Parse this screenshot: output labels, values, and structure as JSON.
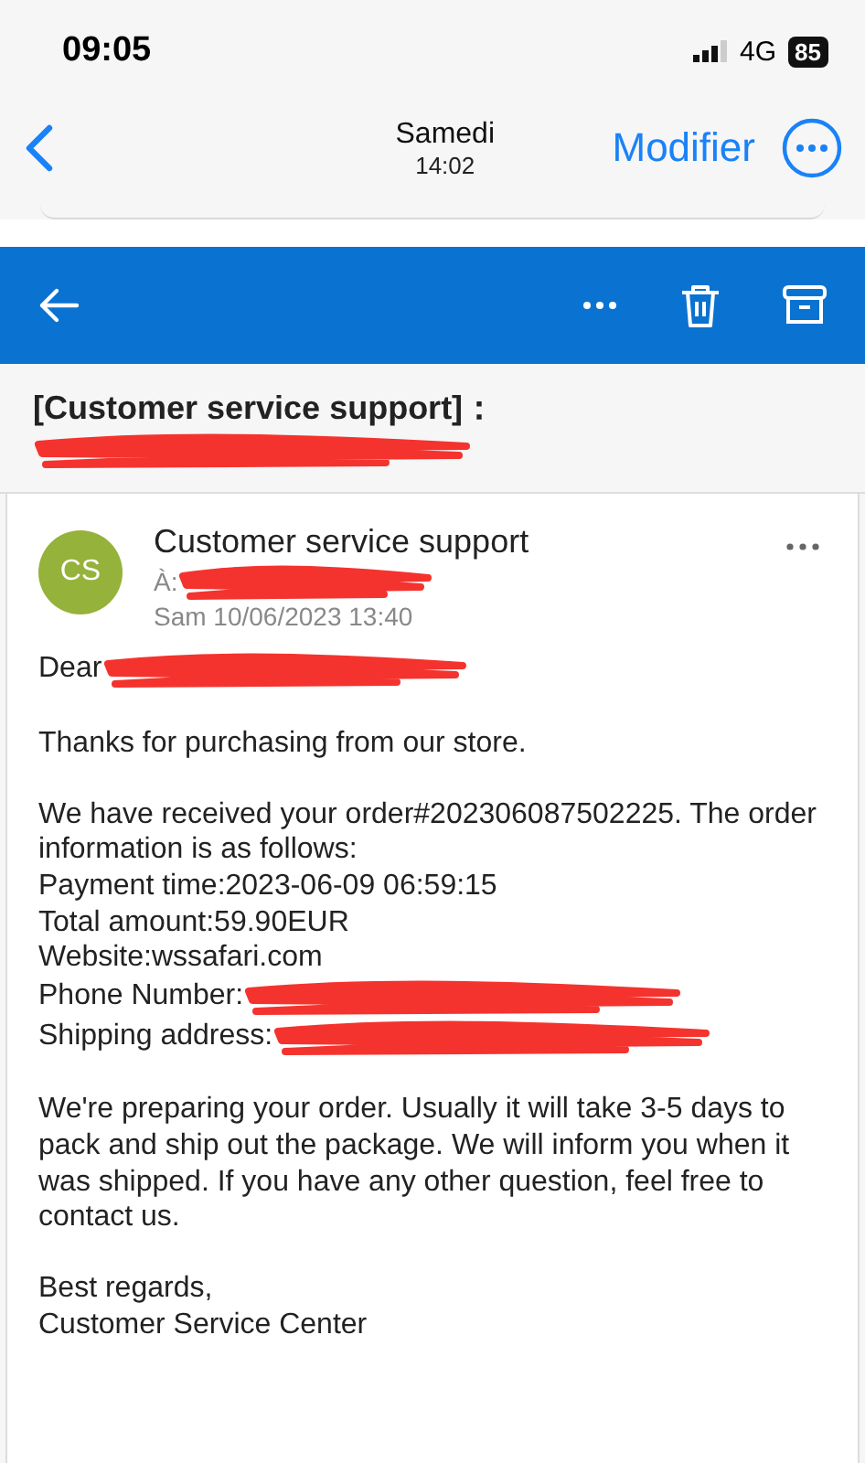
{
  "status_bar": {
    "time": "09:05",
    "network": "4G",
    "battery": "85"
  },
  "nav": {
    "title": "Samedi",
    "subtitle": "14:02",
    "action": "Modifier"
  },
  "subject": {
    "title": "[Customer service support]：",
    "redacted": true
  },
  "message": {
    "avatar": "CS",
    "sender": "Customer service support",
    "to": "À:",
    "to_redacted": true,
    "date": "Sam 10/06/2023 13:40",
    "paragraphs": [
      [
        {
          "text": "Dear",
          "redacted": true
        }
      ],
      [
        {
          "text": "Thanks for purchasing from our store.",
          "redacted": false
        }
      ],
      [
        {
          "text": "We have received your order#202306087502225. The order information is as follows:",
          "redacted": false
        },
        {
          "text": "Payment time:2023-06-09 06:59:15",
          "redacted": false
        },
        {
          "text": "Total amount:59.90EUR",
          "redacted": false
        },
        {
          "text": "Website:wssafari.com",
          "redacted": false
        },
        {
          "text": "Phone Number:",
          "redacted": true
        },
        {
          "text": "Shipping address:",
          "redacted": true
        }
      ],
      [
        {
          "text": "We're preparing your order. Usually it will take 3-5 days to pack and ship out the package. We will inform you when it was shipped. If you have any other question, feel free to contact us.",
          "redacted": false
        }
      ],
      [
        {
          "text": "Best regards,",
          "redacted": false
        },
        {
          "text": "Customer Service Center",
          "redacted": false
        }
      ]
    ]
  }
}
